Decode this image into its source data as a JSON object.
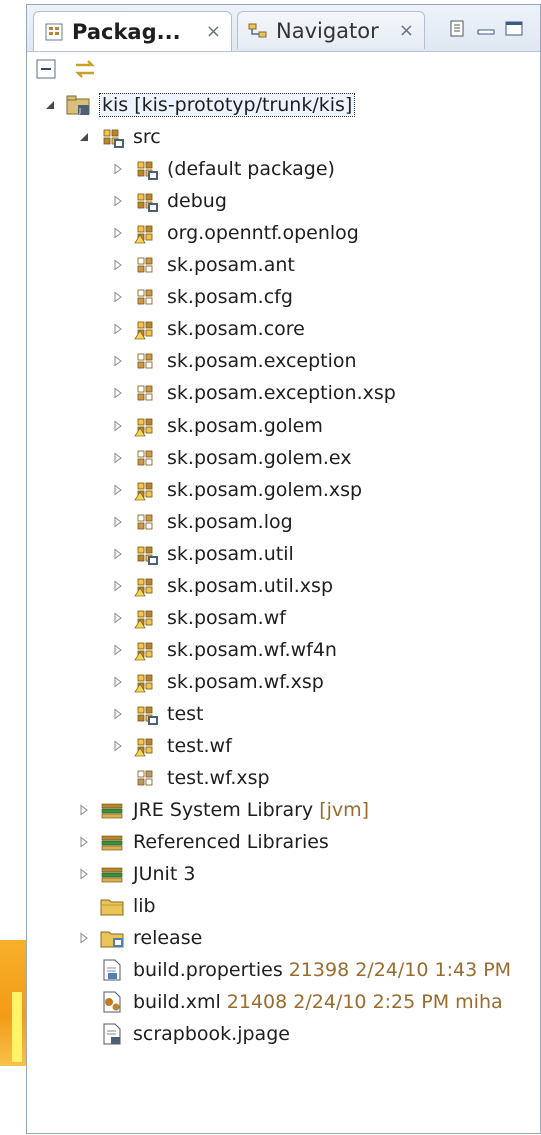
{
  "tabs": [
    {
      "label": "Packag...",
      "close": "×",
      "active": true
    },
    {
      "label": "Navigator",
      "close": "×",
      "active": false
    }
  ],
  "icons": {
    "package_explorer": "package-explorer-icon",
    "navigator": "navigator-icon",
    "minimize": "minimize-icon",
    "maximize": "maximize-icon",
    "collapse_all": "collapse-all-icon",
    "link_editor": "link-with-editor-icon"
  },
  "tree": {
    "project": {
      "label": "kis [kis-prototyp/trunk/kis]"
    },
    "src": {
      "label": "src"
    },
    "packages": [
      {
        "label": "(default package)",
        "kind": "pkg-full"
      },
      {
        "label": "debug",
        "kind": "pkg-full"
      },
      {
        "label": "org.openntf.openlog",
        "kind": "pkg-svn"
      },
      {
        "label": "sk.posam.ant",
        "kind": "pkg-empty"
      },
      {
        "label": "sk.posam.cfg",
        "kind": "pkg-empty"
      },
      {
        "label": "sk.posam.core",
        "kind": "pkg-svn"
      },
      {
        "label": "sk.posam.exception",
        "kind": "pkg-empty"
      },
      {
        "label": "sk.posam.exception.xsp",
        "kind": "pkg-empty"
      },
      {
        "label": "sk.posam.golem",
        "kind": "pkg-svn"
      },
      {
        "label": "sk.posam.golem.ex",
        "kind": "pkg-empty"
      },
      {
        "label": "sk.posam.golem.xsp",
        "kind": "pkg-svn"
      },
      {
        "label": "sk.posam.log",
        "kind": "pkg-empty"
      },
      {
        "label": "sk.posam.util",
        "kind": "pkg-full"
      },
      {
        "label": "sk.posam.util.xsp",
        "kind": "pkg-svn"
      },
      {
        "label": "sk.posam.wf",
        "kind": "pkg-svn"
      },
      {
        "label": "sk.posam.wf.wf4n",
        "kind": "pkg-svn"
      },
      {
        "label": "sk.posam.wf.xsp",
        "kind": "pkg-svn"
      },
      {
        "label": "test",
        "kind": "pkg-full"
      },
      {
        "label": "test.wf",
        "kind": "pkg-svn"
      },
      {
        "label": "test.wf.xsp",
        "kind": "pkg-plain"
      }
    ],
    "libraries": [
      {
        "label": "JRE System Library",
        "decoration": "[jvm]"
      },
      {
        "label": "Referenced Libraries"
      },
      {
        "label": "JUnit 3"
      }
    ],
    "folders": [
      {
        "label": "lib"
      },
      {
        "label": "release"
      }
    ],
    "files": [
      {
        "label": "build.properties",
        "decoration": "21398  2/24/10 1:43 PM"
      },
      {
        "label": "build.xml",
        "decoration": "21408  2/24/10 2:25 PM  miha"
      },
      {
        "label": "scrapbook.jpage"
      }
    ]
  },
  "colors": {
    "package_brown": "#b8862f",
    "package_light": "#f3c34a",
    "library_green": "#3a8f3a",
    "folder_yellow": "#e9c45a",
    "tab_border": "#b4c0d0"
  }
}
